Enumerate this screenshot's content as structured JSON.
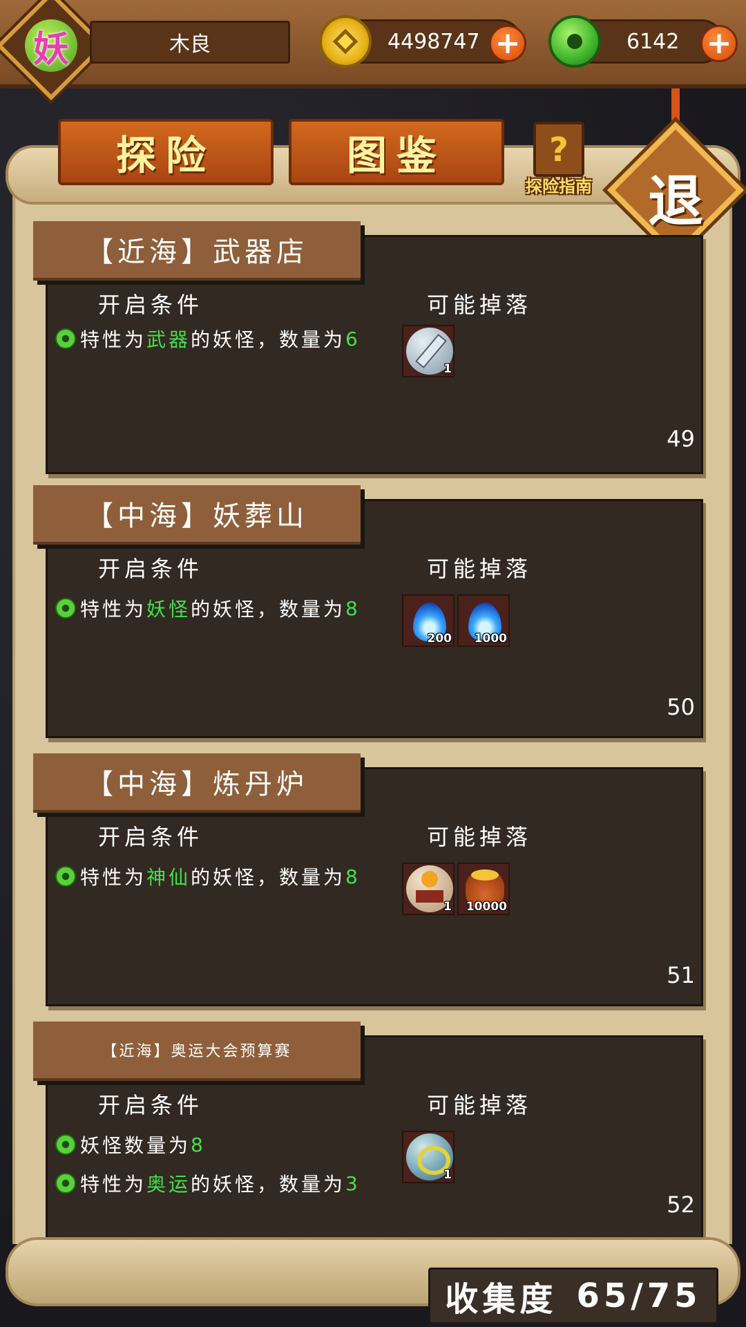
{
  "player": {
    "avatar_char": "妖",
    "name": "木良"
  },
  "currency": {
    "coins": "4498747",
    "jade": "6142",
    "plus": "+"
  },
  "tabs": [
    {
      "label": "探险"
    },
    {
      "label": "图鉴"
    }
  ],
  "guide": {
    "book_glyph": "?",
    "label": "探险指南"
  },
  "exit": {
    "label": "退"
  },
  "labels": {
    "open_condition": "开启条件",
    "possible_drops": "可能掉落"
  },
  "cards": [
    {
      "title": "【近海】武器店",
      "conditions": [
        {
          "pre": "特性为",
          "hl": "武器",
          "post": "的妖怪，数量为",
          "num": "6"
        }
      ],
      "drops": [
        {
          "icon": "sword-orb-icon",
          "qty": "1"
        }
      ],
      "number": "49"
    },
    {
      "title": "【中海】妖葬山",
      "conditions": [
        {
          "pre": "特性为",
          "hl": "妖怪",
          "post": "的妖怪，数量为",
          "num": "8"
        }
      ],
      "drops": [
        {
          "icon": "blue-flame-icon",
          "qty": "200"
        },
        {
          "icon": "blue-flame-icon",
          "qty": "1000"
        }
      ],
      "number": "50"
    },
    {
      "title": "【中海】炼丹炉",
      "conditions": [
        {
          "pre": "特性为",
          "hl": "神仙",
          "post": "的妖怪，数量为",
          "num": "8"
        }
      ],
      "drops": [
        {
          "icon": "altar-orb-icon",
          "qty": "1"
        },
        {
          "icon": "coin-bag-icon",
          "qty": "10000"
        }
      ],
      "number": "51"
    },
    {
      "title": "【近海】奥运大会预算赛",
      "conditions": [
        {
          "pre": "妖怪数量为",
          "hl": "",
          "post": "",
          "num": "8"
        },
        {
          "pre": "特性为",
          "hl": "奥运",
          "post": "的妖怪，数量为",
          "num": "3"
        }
      ],
      "drops": [
        {
          "icon": "olympic-orb-icon",
          "qty": "1"
        }
      ],
      "number": "52"
    }
  ],
  "collection": {
    "label": "收集度",
    "value": "65/75"
  },
  "colors": {
    "highlight": "#45e04a",
    "tab_orange": "#c4591a",
    "card_bg": "#312922"
  }
}
